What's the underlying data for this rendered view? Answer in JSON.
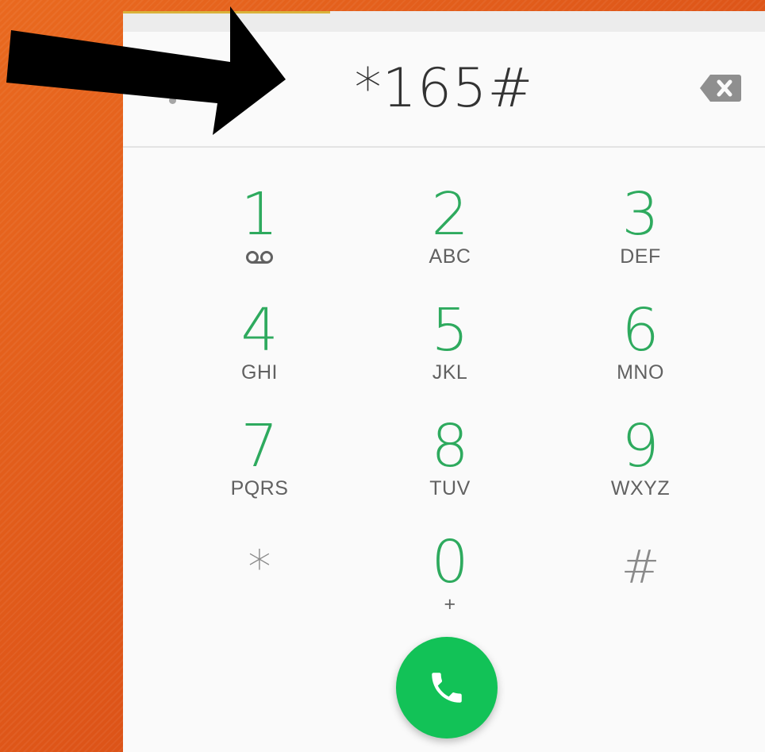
{
  "dialer": {
    "number": "*165#",
    "keys": [
      {
        "digit": "1",
        "letters": "",
        "icon": "voicemail-icon"
      },
      {
        "digit": "2",
        "letters": "ABC"
      },
      {
        "digit": "3",
        "letters": "DEF"
      },
      {
        "digit": "4",
        "letters": "GHI"
      },
      {
        "digit": "5",
        "letters": "JKL"
      },
      {
        "digit": "6",
        "letters": "MNO"
      },
      {
        "digit": "7",
        "letters": "PQRS"
      },
      {
        "digit": "8",
        "letters": "TUV"
      },
      {
        "digit": "9",
        "letters": "WXYZ"
      },
      {
        "digit": "*",
        "letters": ""
      },
      {
        "digit": "0",
        "letters": "+"
      },
      {
        "digit": "#",
        "letters": ""
      }
    ],
    "call_icon": "phone-icon",
    "backspace_icon": "backspace-icon"
  },
  "colors": {
    "digit": "#2eaa5e",
    "call_button": "#12c257",
    "background": "#e0591a",
    "arrow": "#000000"
  },
  "annotation": {
    "arrow_icon": "arrow-icon"
  }
}
